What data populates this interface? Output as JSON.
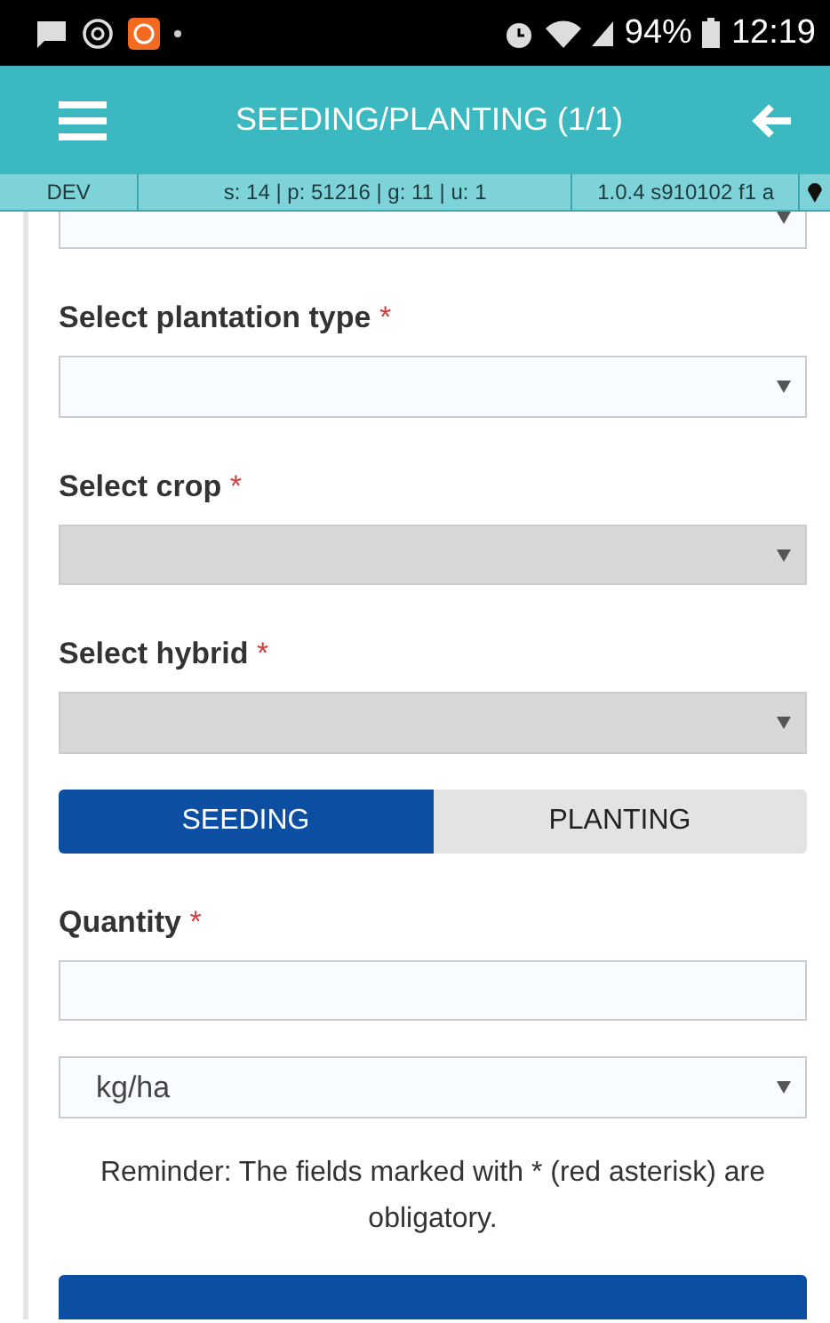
{
  "status_bar": {
    "battery": "94%",
    "time": "12:19"
  },
  "app_bar": {
    "title": "SEEDING/PLANTING (1/1)"
  },
  "info_strip": {
    "env": "DEV",
    "stats": "s: 14 | p: 51216 | g: 11 | u: 1",
    "version": "1.0.4 s910102 f1 a"
  },
  "fields": [
    {
      "kind": "select",
      "label": "Select plantation type",
      "required_mark": "*",
      "disabled": false
    },
    {
      "kind": "select",
      "label": "Select crop",
      "required_mark": "*",
      "disabled": true
    },
    {
      "kind": "select",
      "label": "Select hybrid",
      "required_mark": "*",
      "disabled": true
    },
    {
      "kind": "toggle",
      "options": [
        {
          "label": "SEEDING",
          "selected": true
        },
        {
          "label": "PLANTING",
          "selected": false
        }
      ]
    },
    {
      "kind": "input",
      "label": "Quantity",
      "required_mark": "*",
      "disabled": false
    },
    {
      "kind": "select",
      "value": "kg/ha",
      "disabled": false
    }
  ],
  "reminder": "Reminder: The fields marked with * (red asterisk) are obligatory."
}
